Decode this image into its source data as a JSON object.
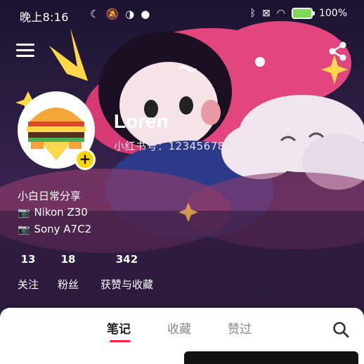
{
  "status_bar": {
    "time": "晚上8:16",
    "battery_percent": "100%",
    "icons": [
      "moon-icon",
      "mute-icon",
      "app-icon",
      "cloud-icon",
      "bluetooth-icon",
      "sim-icon",
      "wifi-icon",
      "battery-charging-icon"
    ]
  },
  "profile": {
    "name": "Loren",
    "red_id": "小红书号：123456789",
    "bio_line": "小白日常分享",
    "cameras": [
      "Nikon Z30",
      "Sony A7C2"
    ],
    "camera_icon": "📷"
  },
  "stats": [
    {
      "value": "13",
      "label": "关注"
    },
    {
      "value": "18",
      "label": "粉丝"
    },
    {
      "value": "342",
      "label": "获赞与收藏"
    }
  ],
  "tabs": {
    "notes": "笔记",
    "collections": "收藏",
    "liked": "赞过",
    "active": "笔记"
  },
  "colors": {
    "accent": "#ff2442",
    "badge": "#ffd400",
    "header_pink": "#e83d7c",
    "header_dark": "#2b1c3f"
  }
}
